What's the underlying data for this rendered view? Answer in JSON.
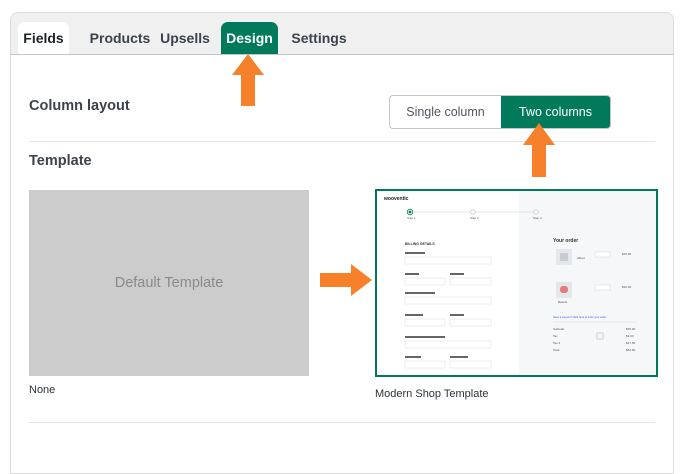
{
  "tabs": [
    {
      "label": "Fields"
    },
    {
      "label": "Products"
    },
    {
      "label": "Upsells"
    },
    {
      "label": "Design"
    },
    {
      "label": "Settings"
    }
  ],
  "active_tab": "Design",
  "column_layout": {
    "title": "Column layout",
    "options": [
      "Single column",
      "Two columns"
    ],
    "selected": "Two columns"
  },
  "template": {
    "title": "Template",
    "default": {
      "preview_text": "Default Template",
      "caption": "None"
    },
    "modern": {
      "caption": "Modern Shop Template",
      "selected": true,
      "preview": {
        "logo": "wooventic",
        "steps": [
          "Step 1",
          "Step 2",
          "Step 3"
        ],
        "billing_heading": "BILLING DETAILS",
        "order_heading": "Your order",
        "products": [
          {
            "name": "Albert",
            "price": "$15.00"
          },
          {
            "name": "Beanie",
            "price": "$20.00"
          }
        ],
        "coupon_text": "Have a coupon? Click here to enter your code",
        "totals": [
          {
            "label": "Subtotal",
            "value": "$35.00"
          },
          {
            "label": "Tax",
            "value": "$3.00"
          },
          {
            "label": "Tax 2",
            "value": "$27.50"
          },
          {
            "label": "Total",
            "value": "$62.50"
          }
        ]
      }
    }
  },
  "colors": {
    "accent": "#017a5b",
    "arrow": "#f7802a"
  }
}
